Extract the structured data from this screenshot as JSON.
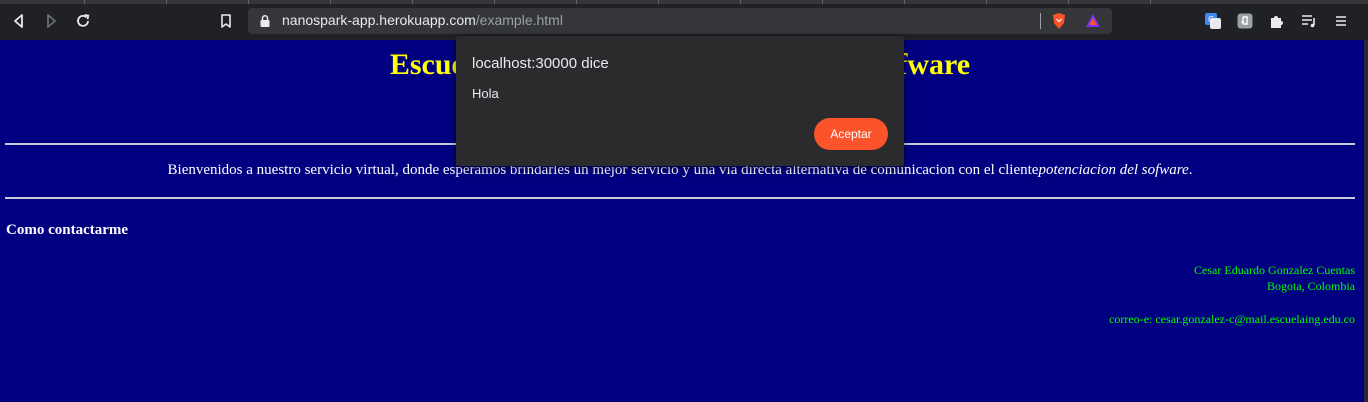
{
  "browser": {
    "url_host": "nanospark-app.herokuapp.com",
    "url_path": "/example.html",
    "icons": [
      "back-icon",
      "forward-icon",
      "reload-icon",
      "bookmark-icon",
      "lock-icon",
      "brave-shields-icon",
      "brave-rewards-icon",
      "translate-icon",
      "extension-icon",
      "puzzle-extensions-icon",
      "media-playlist-icon",
      "menu-icon"
    ]
  },
  "page": {
    "title": "Escuela colombiana de ingenieria del sofware",
    "welcome_text": "Bienvenidos a nuestro servicio virtual, donde esperamos brindarles un mejor servicio y una via directa alternativa de comunicacion con el cliente",
    "welcome_emphasis": "potenciacion del sofware",
    "welcome_end": ".",
    "contact_heading": "Como contactarme",
    "contact_name": "Cesar Eduardo Gonzalez Cuentas",
    "contact_city": "Bogota, Colombia",
    "contact_email": "correo-e: cesar.gonzalez-c@mail.escuelaing.edu.co"
  },
  "dialog": {
    "origin": "localhost:30000 dice",
    "message": "Hola",
    "ok_label": "Aceptar"
  },
  "colors": {
    "page_background": "#000080",
    "title": "#ffff00",
    "address_text": "#00ff00",
    "accent_button": "#fb542b"
  }
}
